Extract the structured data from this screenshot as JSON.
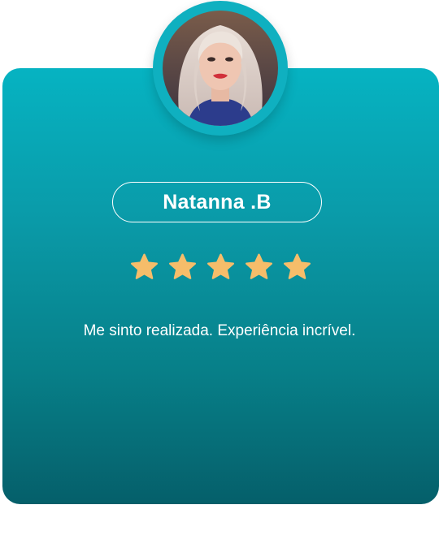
{
  "review": {
    "name": "Natanna .B",
    "rating": 5,
    "rating_max": 5,
    "text": "Me sinto realizada. Experiência incrível."
  },
  "colors": {
    "card_top": "#06b3c2",
    "card_bottom": "#055f6a",
    "star": "#f6bd6a",
    "text": "#ffffff"
  },
  "icons": {
    "star": "star-icon",
    "avatar": "profile-photo"
  }
}
